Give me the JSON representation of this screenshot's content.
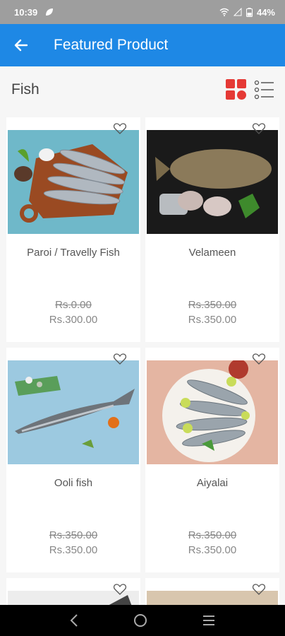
{
  "status": {
    "time": "10:39",
    "battery": "44%"
  },
  "app_bar": {
    "title": "Featured Product"
  },
  "category": "Fish",
  "products": [
    {
      "name": "Paroi  / Travelly Fish",
      "old_price": "Rs.0.00",
      "price": "Rs.300.00"
    },
    {
      "name": "Velameen",
      "old_price": "Rs.350.00",
      "price": "Rs.350.00"
    },
    {
      "name": "Ooli fish",
      "old_price": "Rs.350.00",
      "price": "Rs.350.00"
    },
    {
      "name": "Aiyalai",
      "old_price": "Rs.350.00",
      "price": "Rs.350.00"
    }
  ],
  "colors": {
    "app_bar": "#1e88e5",
    "accent": "#e53935"
  }
}
